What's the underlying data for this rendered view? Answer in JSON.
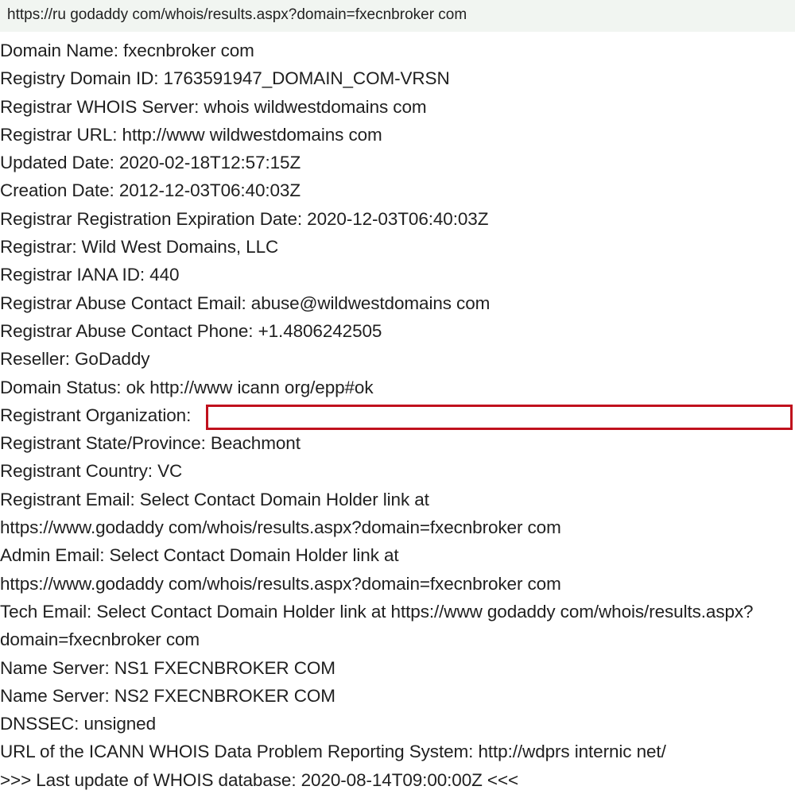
{
  "address_bar": {
    "url": "https://ru godaddy com/whois/results.aspx?domain=fxecnbroker com"
  },
  "whois": {
    "lines": [
      "Domain Name: fxecnbroker com",
      "Registry Domain ID: 1763591947_DOMAIN_COM-VRSN",
      "Registrar WHOIS Server: whois wildwestdomains com",
      "Registrar URL: http://www wildwestdomains com",
      "Updated Date: 2020-02-18T12:57:15Z",
      "Creation Date: 2012-12-03T06:40:03Z",
      "Registrar Registration Expiration Date: 2020-12-03T06:40:03Z",
      "Registrar: Wild West Domains, LLC",
      "Registrar IANA ID: 440",
      "Registrar Abuse Contact Email: abuse@wildwestdomains com",
      "Registrar Abuse Contact Phone: +1.4806242505",
      "Reseller: GoDaddy",
      "Domain Status: ok http://www icann org/epp#ok",
      "Registrant Organization:",
      "Registrant State/Province: Beachmont",
      "Registrant Country: VC",
      "Registrant Email: Select Contact Domain Holder link at",
      "https://www.godaddy com/whois/results.aspx?domain=fxecnbroker com",
      "Admin Email: Select Contact Domain Holder link at",
      "https://www.godaddy com/whois/results.aspx?domain=fxecnbroker com",
      "Tech Email: Select Contact Domain Holder link at https://www godaddy com/whois/results.aspx?",
      "domain=fxecnbroker com",
      "Name Server: NS1 FXECNBROKER COM",
      "Name Server: NS2 FXECNBROKER COM",
      "DNSSEC: unsigned",
      "URL of the ICANN WHOIS Data Problem Reporting System: http://wdprs internic net/",
      ">>> Last update of WHOIS database: 2020-08-14T09:00:00Z <<<"
    ]
  },
  "colors": {
    "address_bar_background": "#f1f5f1",
    "text": "#1f1f1f",
    "redaction_border": "#c0111d"
  }
}
